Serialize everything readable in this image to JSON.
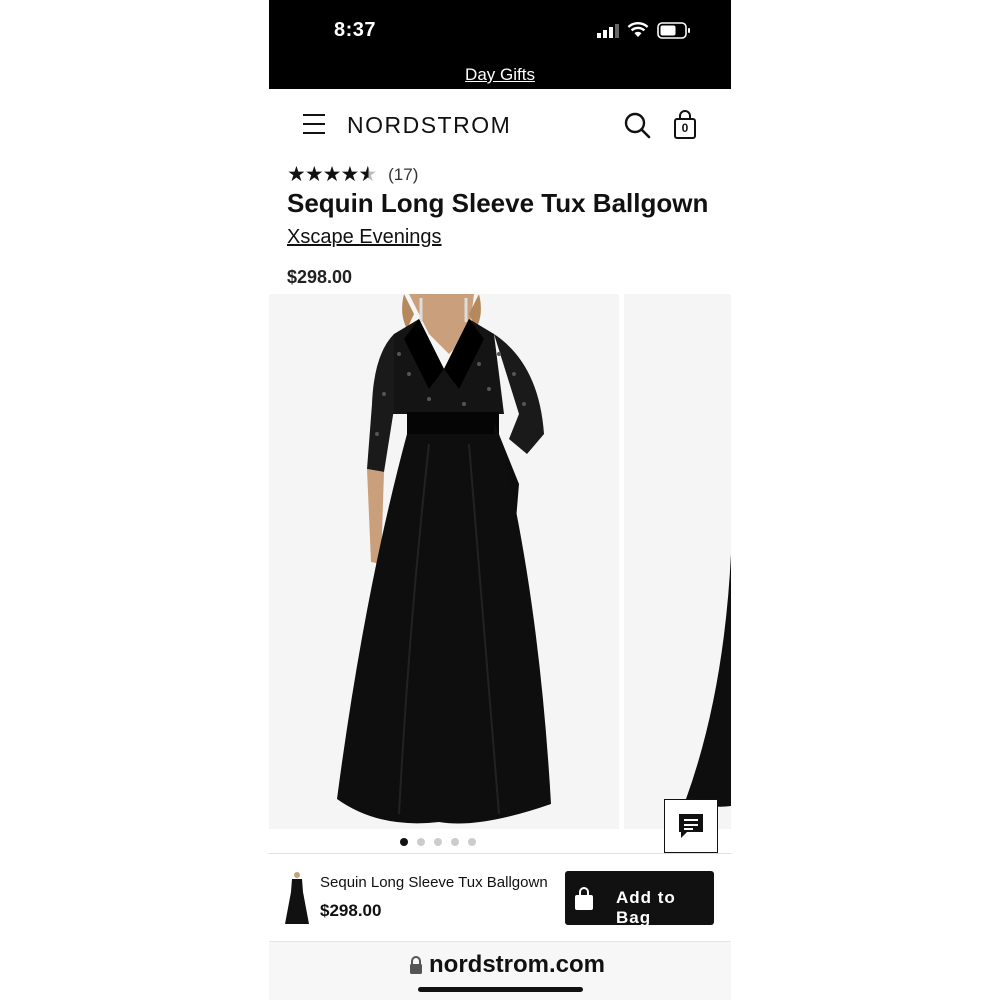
{
  "status_bar": {
    "time": "8:37"
  },
  "promo_banner": {
    "text": "Day Gifts"
  },
  "header": {
    "logo": "NORDSTROM",
    "bag_count": "0"
  },
  "product": {
    "rating": 4.5,
    "review_count": "(17)",
    "title": "Sequin Long Sleeve Tux Ballgown",
    "brand": "Xscape Evenings",
    "price": "$298.00"
  },
  "gallery": {
    "image_count": 5,
    "active_index": 0
  },
  "sticky_bar": {
    "title": "Sequin Long Sleeve Tux Ballgown",
    "price": "$298.00",
    "add_to_bag_label": "Add to Bag"
  },
  "browser": {
    "url": "nordstrom.com"
  },
  "colors": {
    "primary": "#111111",
    "status_bar_bg": "#000000",
    "image_bg": "#f5f5f5"
  },
  "icons": [
    "hamburger-icon",
    "search-icon",
    "shopping-bag-icon",
    "star-icon",
    "chat-icon",
    "lock-icon"
  ]
}
